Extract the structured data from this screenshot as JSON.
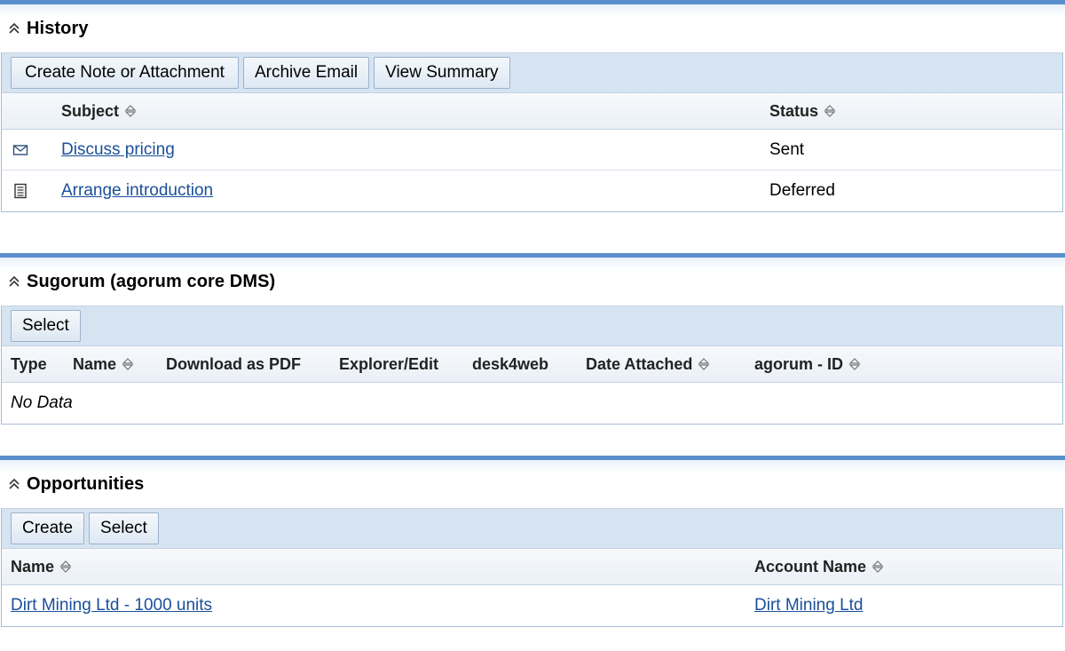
{
  "history": {
    "title": "History",
    "buttons": {
      "create_note": "Create Note or Attachment",
      "archive_email": "Archive Email",
      "view_summary": "View Summary"
    },
    "columns": {
      "subject": "Subject",
      "status": "Status"
    },
    "rows": [
      {
        "icon": "email-icon",
        "subject": "Discuss pricing",
        "status": "Sent"
      },
      {
        "icon": "note-icon",
        "subject": "Arrange introduction",
        "status": "Deferred"
      }
    ]
  },
  "sugorum": {
    "title": "Sugorum (agorum core DMS)",
    "buttons": {
      "select": "Select"
    },
    "columns": {
      "type": "Type",
      "name": "Name",
      "download_pdf": "Download as PDF",
      "explorer_edit": "Explorer/Edit",
      "desk4web": "desk4web",
      "date_attached": "Date Attached",
      "agorum_id": "agorum - ID"
    },
    "empty_text": "No Data"
  },
  "opportunities": {
    "title": "Opportunities",
    "buttons": {
      "create": "Create",
      "select": "Select"
    },
    "columns": {
      "name": "Name",
      "account_name": "Account Name"
    },
    "rows": [
      {
        "name": "Dirt Mining Ltd - 1000 units",
        "account_name": "Dirt Mining Ltd"
      }
    ]
  },
  "colors": {
    "panel_bar": "#5b8fcc",
    "button_bar": "#d6e4f2",
    "link": "#1a4f9a"
  }
}
